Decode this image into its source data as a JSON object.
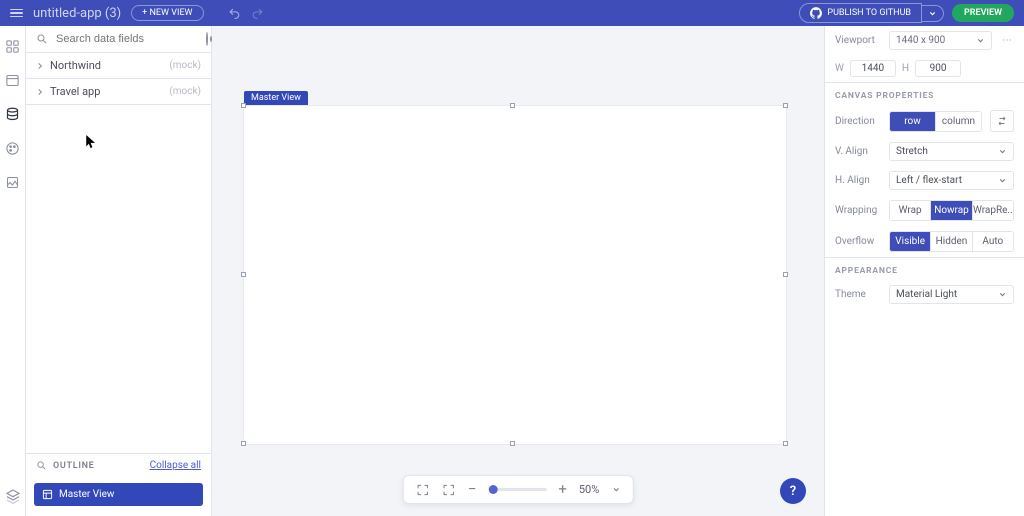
{
  "header": {
    "app_title": "untitled-app (3)",
    "new_view_label": "+ NEW VIEW",
    "publish_label": "PUBLISH TO GITHUB",
    "preview_label": "PREVIEW"
  },
  "sidebar": {
    "search_placeholder": "Search data fields",
    "sources": [
      {
        "name": "Northwind",
        "tag": "(mock)"
      },
      {
        "name": "Travel app",
        "tag": "(mock)"
      }
    ],
    "outline_label": "OUTLINE",
    "collapse_label": "Collapse all",
    "outline_item": "Master View"
  },
  "canvas": {
    "artboard_tag": "Master View",
    "zoom_percent": "50%"
  },
  "inspector": {
    "viewport": {
      "label": "Viewport",
      "value": "1440 x 900"
    },
    "width": {
      "label": "W",
      "value": "1440"
    },
    "height": {
      "label": "H",
      "value": "900"
    },
    "section_canvas": "CANVAS PROPERTIES",
    "direction": {
      "label": "Direction",
      "options": [
        "row",
        "column"
      ],
      "selected": "row"
    },
    "valign": {
      "label": "V. Align",
      "value": "Stretch"
    },
    "halign": {
      "label": "H. Align",
      "value": "Left / flex-start"
    },
    "wrapping": {
      "label": "Wrapping",
      "options": [
        "Wrap",
        "Nowrap",
        "WrapRe.."
      ],
      "selected": "Nowrap"
    },
    "overflow": {
      "label": "Overflow",
      "options": [
        "Visible",
        "Hidden",
        "Auto"
      ],
      "selected": "Visible"
    },
    "section_appearance": "APPEARANCE",
    "theme": {
      "label": "Theme",
      "value": "Material Light"
    }
  }
}
